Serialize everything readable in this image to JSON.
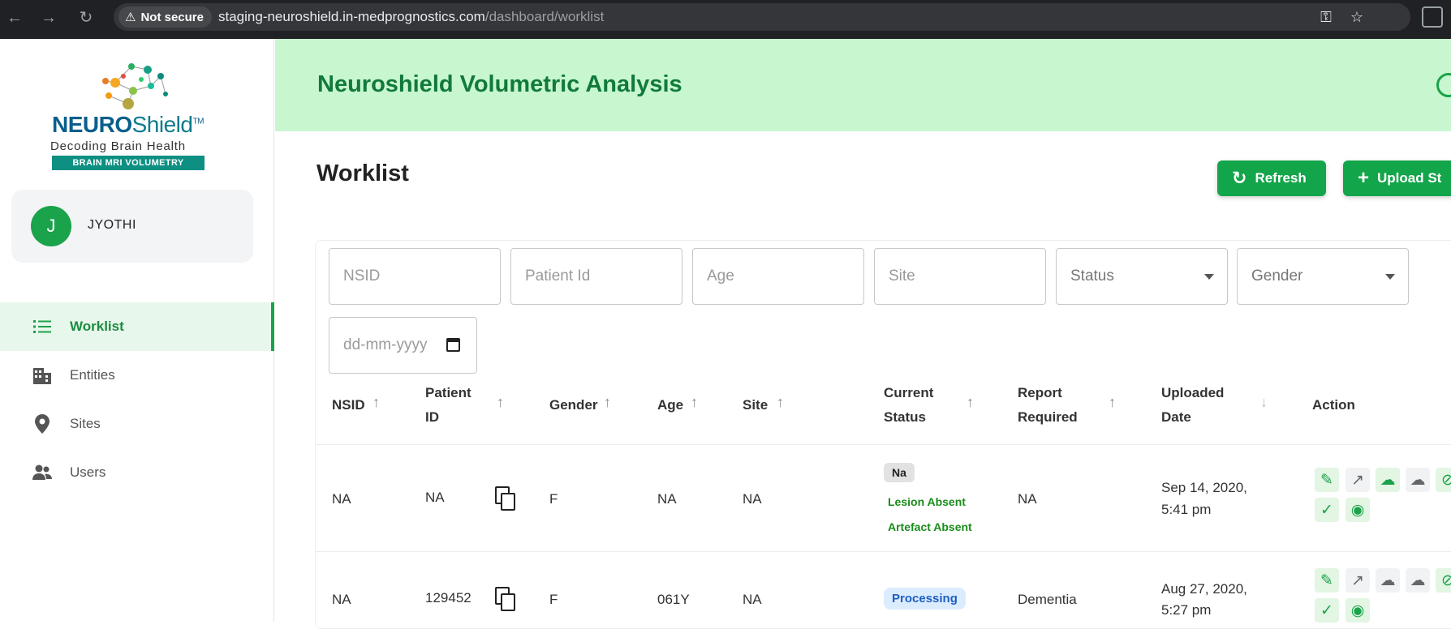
{
  "browser": {
    "security_label": "Not secure",
    "url_host": "staging-neuroshield.in-medprognostics.com",
    "url_path": "/dashboard/worklist"
  },
  "sidebar": {
    "brand_bold": "NEURO",
    "brand_light": "Shield",
    "brand_tm": "TM",
    "tagline": "Decoding Brain Health",
    "band": "BRAIN MRI VOLUMETRY",
    "user": {
      "initial": "J",
      "name": "JYOTHI"
    },
    "items": [
      {
        "label": "Worklist",
        "icon": "list-icon",
        "active": true
      },
      {
        "label": "Entities",
        "icon": "building-icon",
        "active": false
      },
      {
        "label": "Sites",
        "icon": "location-pin-icon",
        "active": false
      },
      {
        "label": "Users",
        "icon": "users-icon",
        "active": false
      }
    ]
  },
  "header": {
    "title": "Neuroshield Volumetric Analysis"
  },
  "page": {
    "title": "Worklist",
    "refresh_label": "Refresh",
    "upload_label": "Upload St"
  },
  "filters": {
    "nsid": "NSID",
    "patient_id": "Patient Id",
    "age": "Age",
    "site": "Site",
    "status": "Status",
    "gender": "Gender",
    "date": "dd-mm-yyyy"
  },
  "table": {
    "headers": {
      "nsid": "NSID",
      "patient_id_1": "Patient",
      "patient_id_2": "ID",
      "gender": "Gender",
      "age": "Age",
      "site": "Site",
      "status_1": "Current",
      "status_2": "Status",
      "report_1": "Report",
      "report_2": "Required",
      "uploaded_1": "Uploaded",
      "uploaded_2": "Date",
      "action": "Action"
    },
    "rows": [
      {
        "nsid": "NA",
        "patient_id": "NA",
        "gender": "F",
        "age": "NA",
        "site": "NA",
        "status_chip": "Na",
        "lesion": "Lesion Absent",
        "artefact": "Artefact Absent",
        "report": "NA",
        "date_1": "Sep 14, 2020,",
        "date_2": "5:41 pm"
      },
      {
        "nsid": "NA",
        "patient_id": "129452",
        "gender": "F",
        "age": "061Y",
        "site": "NA",
        "status_chip": "Processing",
        "report": "Dementia",
        "date_1": "Aug 27, 2020,",
        "date_2": "5:27 pm"
      }
    ]
  },
  "colors": {
    "accent": "#13a54a",
    "banner": "#c8f7cf",
    "title_green": "#117a3a",
    "processing_bg": "#dcecff",
    "processing_text": "#1d5fbf"
  }
}
